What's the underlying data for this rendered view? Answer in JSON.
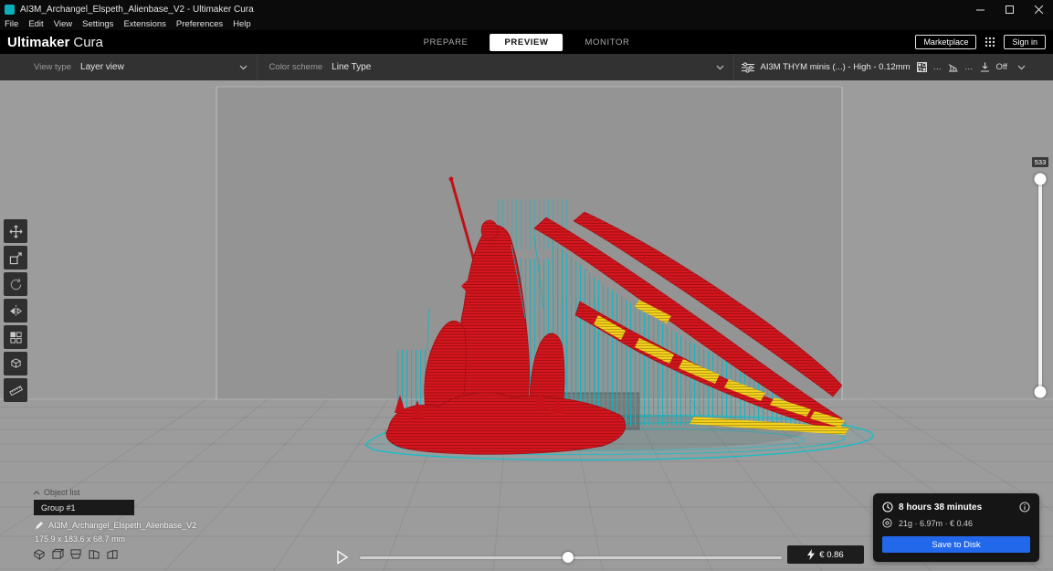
{
  "titlebar": {
    "title": "AI3M_Archangel_Elspeth_Alienbase_V2 - Ultimaker Cura"
  },
  "menubar": {
    "items": [
      "File",
      "Edit",
      "View",
      "Settings",
      "Extensions",
      "Preferences",
      "Help"
    ]
  },
  "header": {
    "logo_primary": "Ultimaker",
    "logo_secondary": "Cura",
    "tabs": [
      {
        "label": "PREPARE"
      },
      {
        "label": "PREVIEW"
      },
      {
        "label": "MONITOR"
      }
    ],
    "marketplace_button": "Marketplace",
    "sign_in_button": "Sign in"
  },
  "view_bar": {
    "view_type_label": "View type",
    "view_type_value": "Layer view",
    "color_scheme_label": "Color scheme",
    "color_scheme_value": "Line Type",
    "print_config": "AI3M THYM minis (...) - High - 0.12mm",
    "infill_value": "…",
    "support_value": "…",
    "adhesion_value": "Off"
  },
  "layer_slider": {
    "current_layer": "533"
  },
  "object_panel": {
    "object_list_label": "Object list",
    "group_label": "Group #1",
    "model_name": "AI3M_Archangel_Elspeth_Alienbase_V2",
    "model_dimensions": "175.9 x 183.6 x 68.7 mm"
  },
  "print_summary": {
    "time": "8 hours 38 minutes",
    "material": "21g · 6.97m · € 0.46",
    "save_button": "Save to Disk"
  },
  "cost_badge": {
    "value": "€ 0.86"
  },
  "colors": {
    "accent_blue": "#2268eb",
    "layer_red": "#d8161f",
    "support_cyan": "#12b9c5",
    "interface_yellow": "#f2cf1d"
  }
}
